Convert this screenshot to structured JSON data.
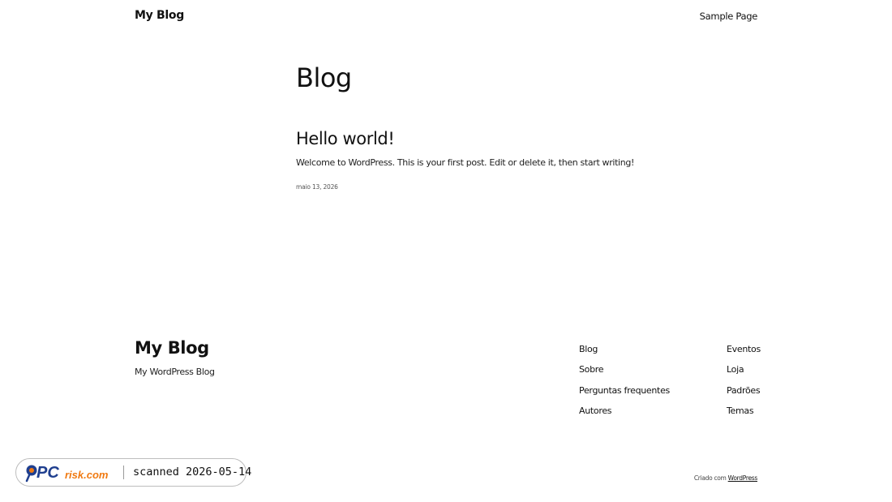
{
  "header": {
    "site_title": "My Blog",
    "nav": [
      {
        "label": "Sample Page"
      }
    ]
  },
  "main": {
    "page_heading": "Blog",
    "posts": [
      {
        "title": "Hello world!",
        "excerpt": "Welcome to WordPress. This is your first post. Edit or delete it, then start writing!",
        "date": "maio 13, 2026"
      }
    ]
  },
  "footer": {
    "title": "My Blog",
    "tagline": "My WordPress Blog",
    "links_col1": [
      {
        "label": "Blog"
      },
      {
        "label": "Sobre"
      },
      {
        "label": "Perguntas frequentes"
      },
      {
        "label": "Autores"
      }
    ],
    "links_col2": [
      {
        "label": "Eventos"
      },
      {
        "label": "Loja"
      },
      {
        "label": "Padrões"
      },
      {
        "label": "Temas"
      }
    ],
    "credit_prefix": "Criado com",
    "credit_link": "WordPress"
  },
  "badge": {
    "logo_text_pc": "PC",
    "logo_text_risk": "risk.com",
    "text": "scanned 2026-05-14",
    "colors": {
      "pc_blue": "#1f3f8f",
      "risk_orange": "#f07a12"
    }
  }
}
